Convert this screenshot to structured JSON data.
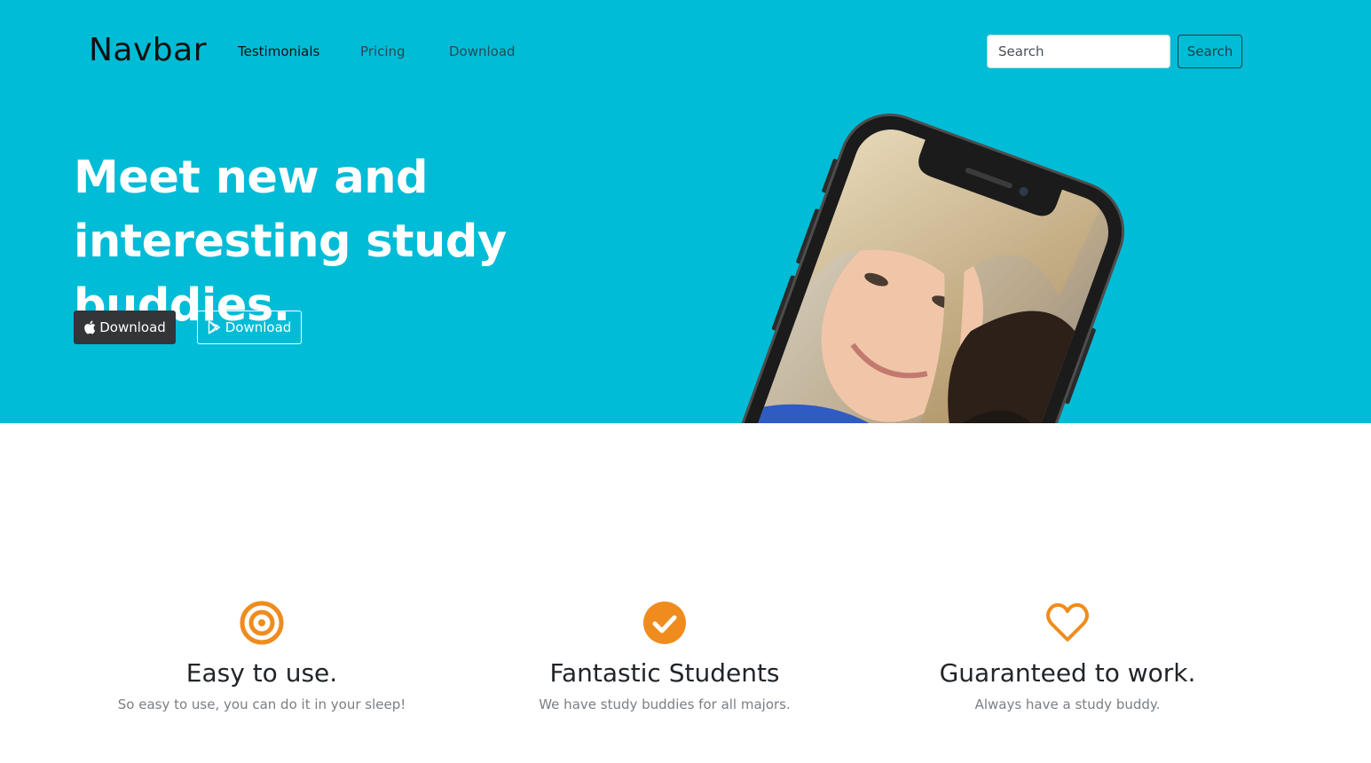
{
  "navbar": {
    "brand": "Navbar",
    "links": [
      {
        "label": "Testimonials",
        "active": true
      },
      {
        "label": "Pricing",
        "active": false
      },
      {
        "label": "Download",
        "active": false
      }
    ],
    "search": {
      "placeholder": "Search",
      "button_label": "Search"
    }
  },
  "hero": {
    "title": "Meet new and interesting study buddies.",
    "buttons": [
      {
        "label": "Download",
        "icon": "apple-icon"
      },
      {
        "label": "Download",
        "icon": "google-play-icon"
      }
    ]
  },
  "features": [
    {
      "icon": "bullseye-icon",
      "title": "Easy to use.",
      "text": "So easy to use, you can do it in your sleep!"
    },
    {
      "icon": "check-circle-icon",
      "title": "Fantastic Students",
      "text": "We have study buddies for all majors."
    },
    {
      "icon": "heart-icon",
      "title": "Guaranteed to work.",
      "text": "Always have a study buddy."
    }
  ],
  "colors": {
    "hero_bg": "#00bcd6",
    "accent": "#ef8c1d",
    "dark_button": "#333538"
  }
}
